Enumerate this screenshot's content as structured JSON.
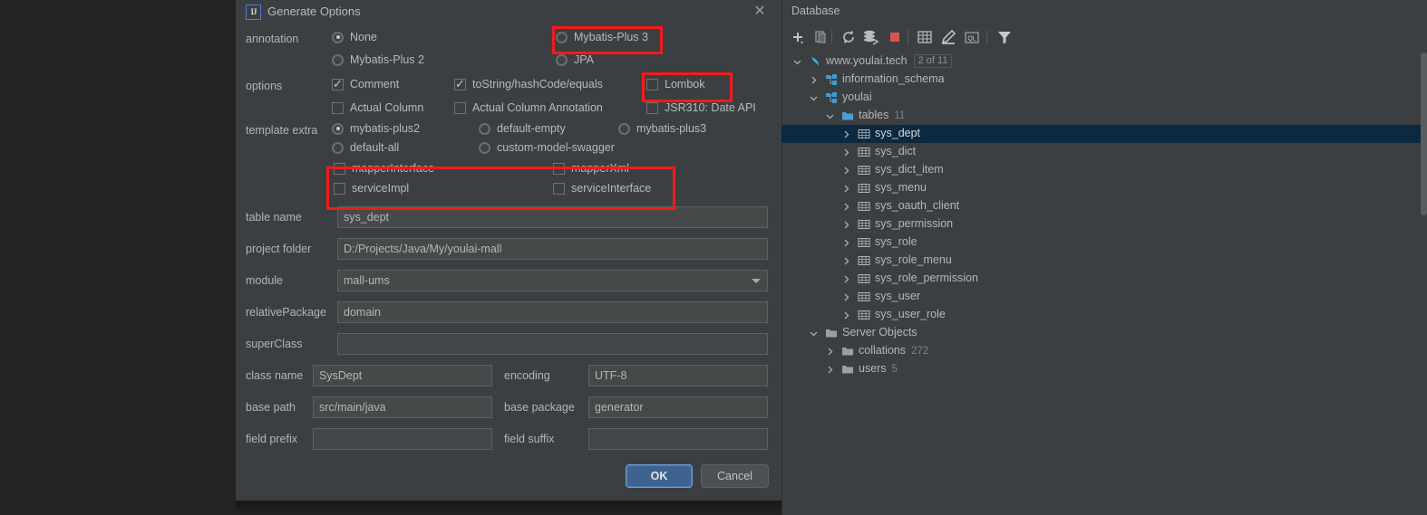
{
  "dialog": {
    "title": "Generate Options",
    "logo_text": "IJ",
    "close_label": "✕",
    "groups": {
      "annotation_label": "annotation",
      "options_label": "options",
      "template_extra_label": "template extra"
    },
    "annotation_options": [
      {
        "label": "None",
        "selected": true
      },
      {
        "label": "Mybatis-Plus 3",
        "selected": false
      },
      {
        "label": "Mybatis-Plus 2",
        "selected": false
      },
      {
        "label": "JPA",
        "selected": false
      }
    ],
    "option_checkboxes": [
      {
        "label": "Comment",
        "checked": true
      },
      {
        "label": "toString/hashCode/equals",
        "checked": true
      },
      {
        "label": "Lombok",
        "checked": false
      },
      {
        "label": "Actual Column",
        "checked": false
      },
      {
        "label": "Actual Column Annotation",
        "checked": false
      },
      {
        "label": "JSR310: Date API",
        "checked": false
      }
    ],
    "template_radios": [
      {
        "label": "mybatis-plus2",
        "selected": true
      },
      {
        "label": "default-empty",
        "selected": false
      },
      {
        "label": "mybatis-plus3",
        "selected": false
      },
      {
        "label": "default-all",
        "selected": false
      },
      {
        "label": "custom-model-swagger",
        "selected": false
      }
    ],
    "template_checkboxes": [
      {
        "label": "mapperInterface",
        "checked": false
      },
      {
        "label": "mapperXml",
        "checked": false
      },
      {
        "label": "serviceImpl",
        "checked": false
      },
      {
        "label": "serviceInterface",
        "checked": false
      }
    ],
    "fields": {
      "table_name": {
        "label": "table name",
        "value": "sys_dept"
      },
      "project_folder": {
        "label": "project folder",
        "value": "D:/Projects/Java/My/youlai-mall"
      },
      "module": {
        "label": "module",
        "value": "mall-ums"
      },
      "relative_package": {
        "label": "relativePackage",
        "value": "domain"
      },
      "super_class": {
        "label": "superClass",
        "value": ""
      },
      "class_name": {
        "label": "class name",
        "value": "SysDept"
      },
      "encoding": {
        "label": "encoding",
        "value": "UTF-8"
      },
      "base_path": {
        "label": "base path",
        "value": "src/main/java"
      },
      "base_package": {
        "label": "base package",
        "value": "generator"
      },
      "field_prefix": {
        "label": "field prefix",
        "value": ""
      },
      "field_suffix": {
        "label": "field suffix",
        "value": ""
      }
    },
    "buttons": {
      "ok": "OK",
      "cancel": "Cancel"
    },
    "highlight_color": "#f31b1b"
  },
  "database": {
    "title": "Database",
    "toolbar": [
      {
        "name": "add-icon",
        "tip": "+"
      },
      {
        "name": "duplicate-icon",
        "tip": "copy"
      },
      {
        "name": "refresh-icon",
        "tip": "refresh"
      },
      {
        "name": "sync-ddl-icon",
        "tip": "sync"
      },
      {
        "name": "stop-icon",
        "tip": "stop"
      },
      {
        "name": "table-view-icon",
        "tip": "table"
      },
      {
        "name": "edit-icon",
        "tip": "edit"
      },
      {
        "name": "query-console-icon",
        "tip": "QL"
      },
      {
        "name": "filter-icon",
        "tip": "filter"
      }
    ],
    "tree": [
      {
        "label": "www.youlai.tech",
        "badge": "2 of 11",
        "count": "",
        "icon": "datasource-icon",
        "depth": 0,
        "twisty": "v",
        "selected": false
      },
      {
        "label": "information_schema",
        "badge": "",
        "count": "",
        "icon": "schema-icon",
        "depth": 1,
        "twisty": ">",
        "selected": false
      },
      {
        "label": "youlai",
        "badge": "",
        "count": "",
        "icon": "schema-icon",
        "depth": 1,
        "twisty": "v",
        "selected": false
      },
      {
        "label": "tables",
        "badge": "",
        "count": "11",
        "icon": "folder-icon",
        "depth": 2,
        "twisty": "v",
        "selected": false
      },
      {
        "label": "sys_dept",
        "badge": "",
        "count": "",
        "icon": "table-icon",
        "depth": 3,
        "twisty": ">",
        "selected": true
      },
      {
        "label": "sys_dict",
        "badge": "",
        "count": "",
        "icon": "table-icon",
        "depth": 3,
        "twisty": ">",
        "selected": false
      },
      {
        "label": "sys_dict_item",
        "badge": "",
        "count": "",
        "icon": "table-icon",
        "depth": 3,
        "twisty": ">",
        "selected": false
      },
      {
        "label": "sys_menu",
        "badge": "",
        "count": "",
        "icon": "table-icon",
        "depth": 3,
        "twisty": ">",
        "selected": false
      },
      {
        "label": "sys_oauth_client",
        "badge": "",
        "count": "",
        "icon": "table-icon",
        "depth": 3,
        "twisty": ">",
        "selected": false
      },
      {
        "label": "sys_permission",
        "badge": "",
        "count": "",
        "icon": "table-icon",
        "depth": 3,
        "twisty": ">",
        "selected": false
      },
      {
        "label": "sys_role",
        "badge": "",
        "count": "",
        "icon": "table-icon",
        "depth": 3,
        "twisty": ">",
        "selected": false
      },
      {
        "label": "sys_role_menu",
        "badge": "",
        "count": "",
        "icon": "table-icon",
        "depth": 3,
        "twisty": ">",
        "selected": false
      },
      {
        "label": "sys_role_permission",
        "badge": "",
        "count": "",
        "icon": "table-icon",
        "depth": 3,
        "twisty": ">",
        "selected": false
      },
      {
        "label": "sys_user",
        "badge": "",
        "count": "",
        "icon": "table-icon",
        "depth": 3,
        "twisty": ">",
        "selected": false
      },
      {
        "label": "sys_user_role",
        "badge": "",
        "count": "",
        "icon": "table-icon",
        "depth": 3,
        "twisty": ">",
        "selected": false
      },
      {
        "label": "Server Objects",
        "badge": "",
        "count": "",
        "icon": "folder-grey-icon",
        "depth": 1,
        "twisty": "v",
        "selected": false
      },
      {
        "label": "collations",
        "badge": "",
        "count": "272",
        "icon": "folder-grey-icon",
        "depth": 2,
        "twisty": ">",
        "selected": false
      },
      {
        "label": "users",
        "badge": "",
        "count": "5",
        "icon": "folder-grey-icon",
        "depth": 2,
        "twisty": ">",
        "selected": false
      }
    ]
  }
}
